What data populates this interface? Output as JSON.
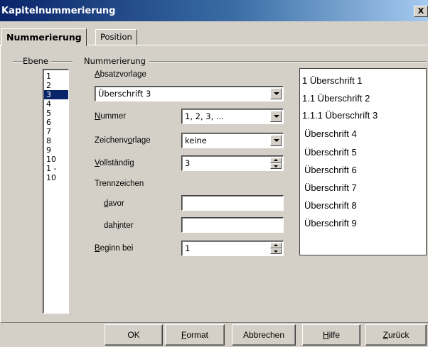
{
  "window": {
    "title": "Kapitelnummerierung",
    "close_label": "X"
  },
  "tabs": [
    {
      "label": "Nummerierung",
      "active": true
    },
    {
      "label": "Position",
      "active": false
    }
  ],
  "groups": {
    "level": "Ebene",
    "numbering": "Nummerierung"
  },
  "levels": {
    "items": [
      "1",
      "2",
      "3",
      "4",
      "5",
      "6",
      "7",
      "8",
      "9",
      "10",
      "1 - 10"
    ],
    "selected": "3"
  },
  "form": {
    "paragraph_style": {
      "label_access": "A",
      "label_rest": "bsatzvorlage",
      "value": "Überschrift 3"
    },
    "number": {
      "label_access": "N",
      "label_rest": "ummer",
      "value": "1, 2, 3, ..."
    },
    "char_style": {
      "label_pre": "Zeichenv",
      "label_access": "o",
      "label_post": "rlage",
      "value": "keine"
    },
    "complete": {
      "label_access": "V",
      "label_rest": "ollständig",
      "value": "3"
    },
    "separator": {
      "label": "Trennzeichen",
      "before_access": "d",
      "before_rest": "avor",
      "before_value": "",
      "after_pre": "dah",
      "after_access": "i",
      "after_post": "nter",
      "after_value": ""
    },
    "start_at": {
      "label_access": "B",
      "label_rest": "eginn bei",
      "value": "1"
    }
  },
  "preview": {
    "lines": [
      "1 Überschrift 1",
      "1.1 Überschrift 2",
      "1.1.1 Überschrift 3",
      "Überschrift 4",
      "Überschrift 5",
      "Überschrift 6",
      "Überschrift 7",
      "Überschrift 8",
      "Überschrift 9"
    ]
  },
  "buttons": {
    "ok": "OK",
    "format_access": "F",
    "format_rest": "ormat",
    "cancel": "Abbrechen",
    "help_access": "H",
    "help_rest": "ilfe",
    "back_access": "Z",
    "back_rest": "urück"
  },
  "colors": {
    "selection": "#0a246a",
    "face": "#d4d0c8",
    "titlebar_start": "#0a246a",
    "titlebar_end": "#a6caf0"
  }
}
